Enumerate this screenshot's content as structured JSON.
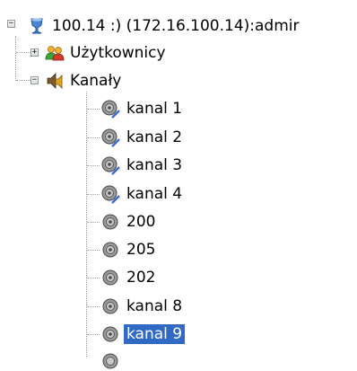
{
  "tree": {
    "root": {
      "label": "100.14 :) (172.16.100.14):admir",
      "expanded": true
    },
    "users": {
      "label": "Użytkownicy",
      "expanded": false
    },
    "channels": {
      "label": "Kanały",
      "expanded": true,
      "items": [
        {
          "label": "kanal 1",
          "icon": "speaker-muted-icon",
          "selected": false
        },
        {
          "label": "kanal 2",
          "icon": "speaker-muted-icon",
          "selected": false
        },
        {
          "label": "kanal 3",
          "icon": "speaker-muted-icon",
          "selected": false
        },
        {
          "label": "kanal 4",
          "icon": "speaker-muted-icon",
          "selected": false
        },
        {
          "label": "200",
          "icon": "speaker-icon",
          "selected": false
        },
        {
          "label": "205",
          "icon": "speaker-icon",
          "selected": false
        },
        {
          "label": "202",
          "icon": "speaker-icon",
          "selected": false
        },
        {
          "label": "kanal 8",
          "icon": "speaker-icon",
          "selected": false
        },
        {
          "label": "kanal 9",
          "icon": "speaker-icon",
          "selected": true
        }
      ]
    }
  },
  "colors": {
    "selection": "#316ac5",
    "lines": "#a0a0a0"
  }
}
